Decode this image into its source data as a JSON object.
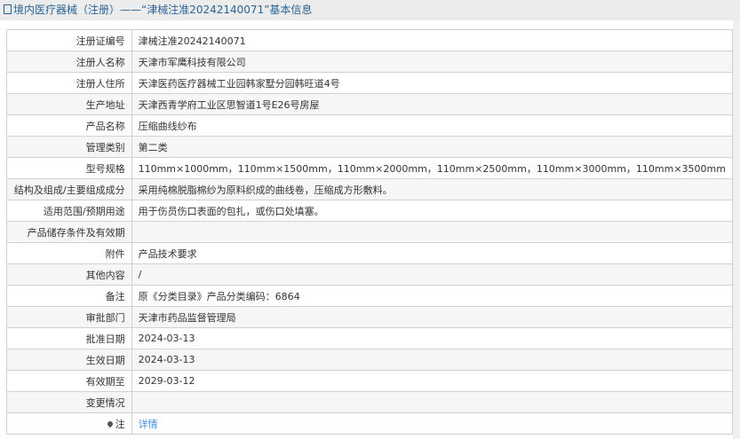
{
  "header": {
    "title": "境内医疗器械（注册）——“津械注准20242140071”基本信息"
  },
  "rows": [
    {
      "label": "注册证编号",
      "value": "津械注准20242140071"
    },
    {
      "label": "注册人名称",
      "value": "天津市军鹰科技有限公司"
    },
    {
      "label": "注册人住所",
      "value": "天津医药医疗器械工业园韩家墅分园韩旺道4号"
    },
    {
      "label": "生产地址",
      "value": "天津西青学府工业区思智道1号E26号房屋"
    },
    {
      "label": "产品名称",
      "value": "压缩曲线纱布"
    },
    {
      "label": "管理类别",
      "value": "第二类"
    },
    {
      "label": "型号规格",
      "value": "110mm×1000mm，110mm×1500mm，110mm×2000mm，110mm×2500mm，110mm×3000mm，110mm×3500mm"
    },
    {
      "label": "结构及组成/主要组成成分",
      "value": "采用纯棉脱脂棉纱为原料织成的曲线卷，压缩成方形敷料。"
    },
    {
      "label": "适用范围/预期用途",
      "value": "用于伤员伤口表面的包扎，或伤口处填塞。"
    },
    {
      "label": "产品储存条件及有效期",
      "value": ""
    },
    {
      "label": "附件",
      "value": "产品技术要求"
    },
    {
      "label": "其他内容",
      "value": "/"
    },
    {
      "label": "备注",
      "value": "原《分类目录》产品分类编码：6864"
    },
    {
      "label": "审批部门",
      "value": "天津市药品监督管理局"
    },
    {
      "label": "批准日期",
      "value": "2024-03-13"
    },
    {
      "label": "生效日期",
      "value": "2024-03-13"
    },
    {
      "label": "有效期至",
      "value": "2029-03-12"
    },
    {
      "label": "变更情况",
      "value": ""
    }
  ],
  "note": {
    "label": "注",
    "link": "详情"
  }
}
